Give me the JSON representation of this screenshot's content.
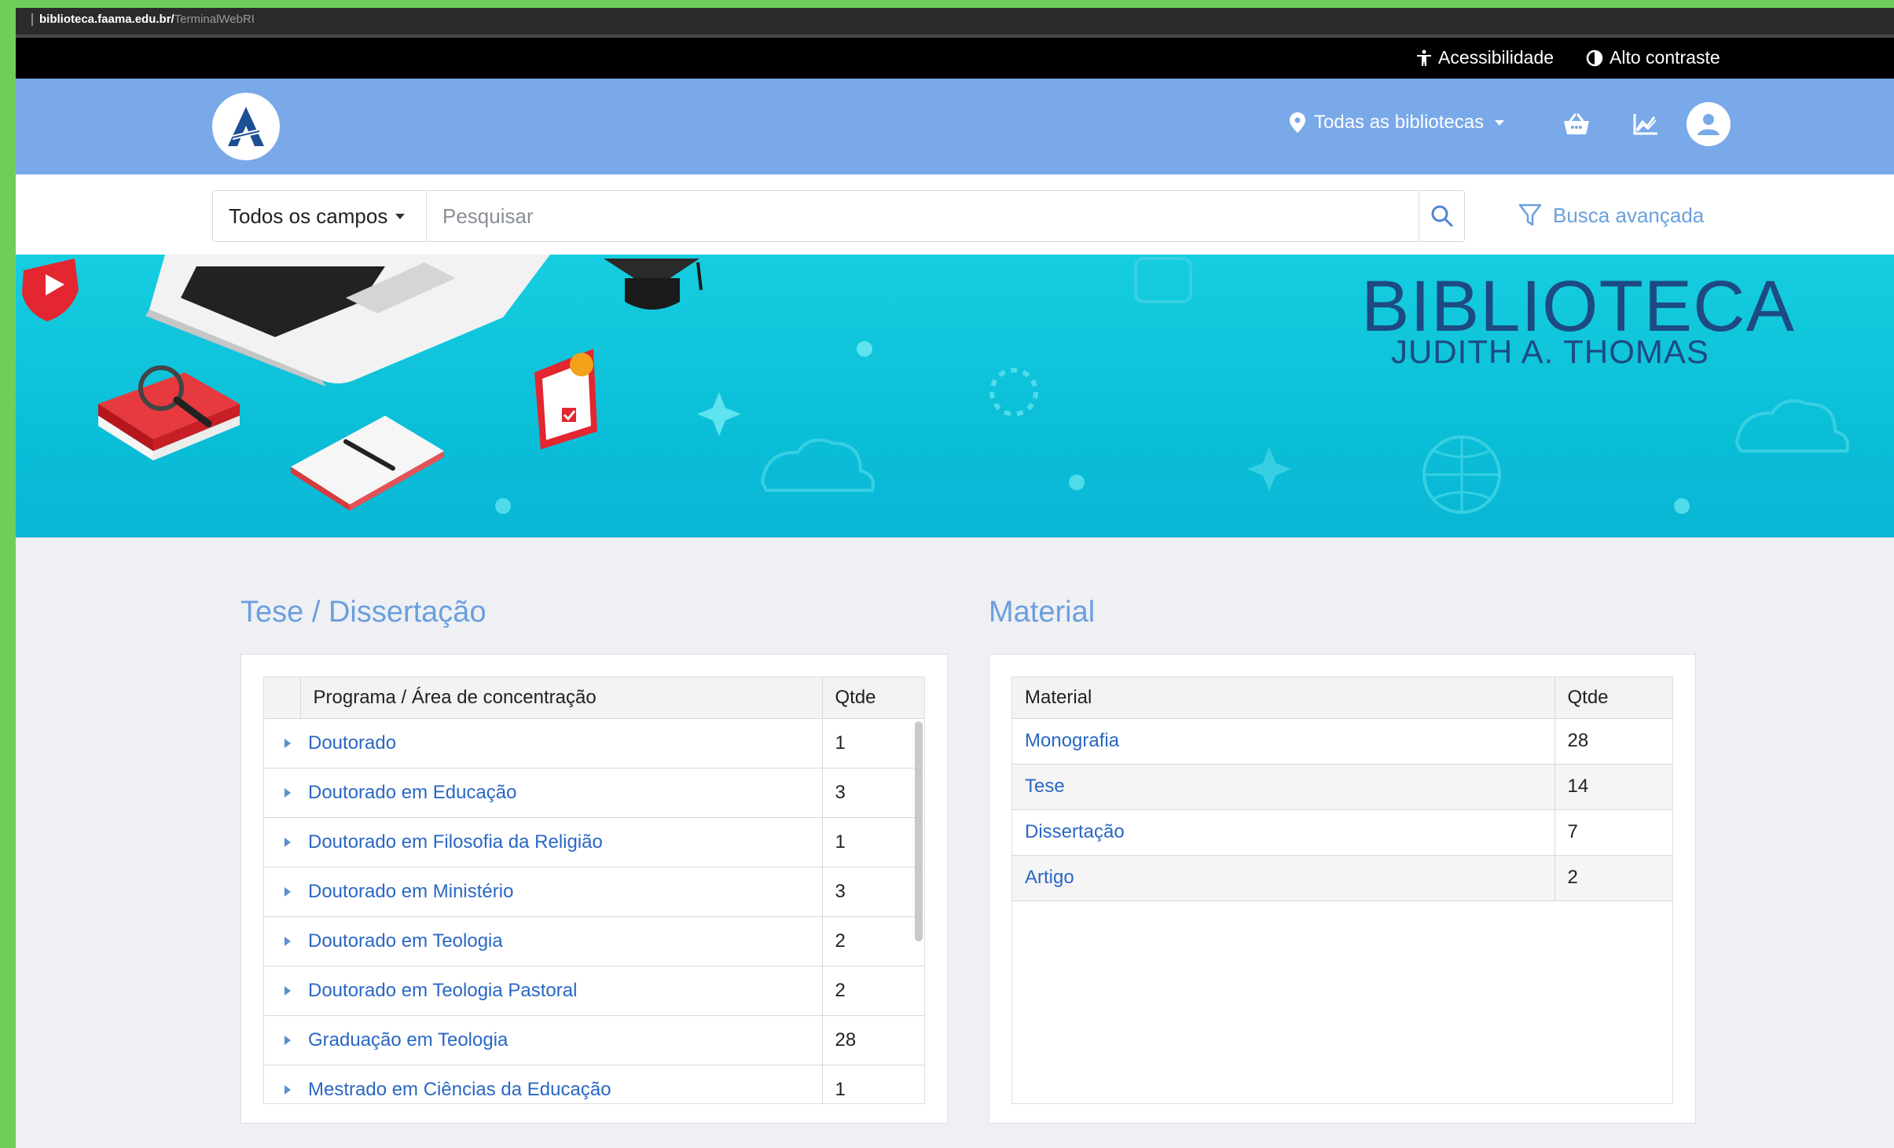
{
  "browser": {
    "url_host": "biblioteca.faama.edu.br/",
    "url_path": "TerminalWebRI"
  },
  "accessibility_bar": {
    "accessibility_label": "Acessibilidade",
    "contrast_label": "Alto contraste"
  },
  "header": {
    "libraries_label": "Todas as bibliotecas"
  },
  "search": {
    "scope_label": "Todos os campos",
    "placeholder": "Pesquisar",
    "advanced_label": "Busca avançada"
  },
  "banner": {
    "title": "BIBLIOTECA",
    "subtitle": "JUDITH A. THOMAS"
  },
  "thesis": {
    "title": "Tese / Dissertação",
    "col_program": "Programa / Área de concentração",
    "col_qty": "Qtde",
    "rows": [
      {
        "label": "Doutorado",
        "qty": "1"
      },
      {
        "label": "Doutorado em Educação",
        "qty": "3"
      },
      {
        "label": "Doutorado em Filosofia da Religião",
        "qty": "1"
      },
      {
        "label": "Doutorado em Ministério",
        "qty": "3"
      },
      {
        "label": "Doutorado em Teologia",
        "qty": "2"
      },
      {
        "label": "Doutorado em Teologia Pastoral",
        "qty": "2"
      },
      {
        "label": "Graduação em Teologia",
        "qty": "28"
      },
      {
        "label": "Mestrado em Ciências da Educação",
        "qty": "1"
      }
    ]
  },
  "material": {
    "title": "Material",
    "col_material": "Material",
    "col_qty": "Qtde",
    "rows": [
      {
        "label": "Monografia",
        "qty": "28"
      },
      {
        "label": "Tese",
        "qty": "14"
      },
      {
        "label": "Dissertação",
        "qty": "7"
      },
      {
        "label": "Artigo",
        "qty": "2"
      }
    ]
  },
  "colors": {
    "header_bg": "#79a9e9",
    "link": "#2a67c4",
    "accent_title": "#6b9fdd",
    "banner_bg": "#16cde0"
  }
}
